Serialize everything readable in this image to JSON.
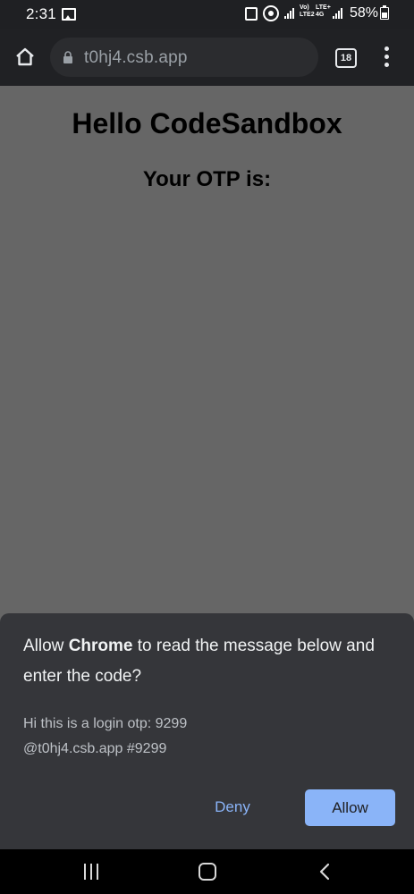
{
  "status_bar": {
    "time": "2:31",
    "volte_label_top": "Vo)",
    "volte_label_bottom": "LTE2",
    "lte_label_top": "LTE+",
    "lte_label_bottom": "4G",
    "battery_percent": "58%"
  },
  "browser": {
    "url": "t0hj4.csb.app",
    "tab_count": "18"
  },
  "page": {
    "heading": "Hello CodeSandbox",
    "subheading": "Your OTP is:"
  },
  "dialog": {
    "title_prefix": "Allow ",
    "title_app": "Chrome",
    "title_suffix": " to read the message below and enter the code?",
    "message_line_1": "Hi this is a login otp: 9299",
    "message_line_2": "@t0hj4.csb.app #9299",
    "deny_label": "Deny",
    "allow_label": "Allow"
  },
  "colors": {
    "page_background": "#666666",
    "toolbar": "#202124",
    "sheet": "#35363a",
    "accent": "#8ab4f8"
  },
  "icons": [
    "gallery-icon",
    "lock-notif-icon",
    "hotspot-icon",
    "signal-icon",
    "battery-icon",
    "home-icon",
    "lock-icon",
    "tab-switcher-icon",
    "more-vert-icon",
    "nav-recents-icon",
    "nav-home-icon",
    "nav-back-icon"
  ]
}
